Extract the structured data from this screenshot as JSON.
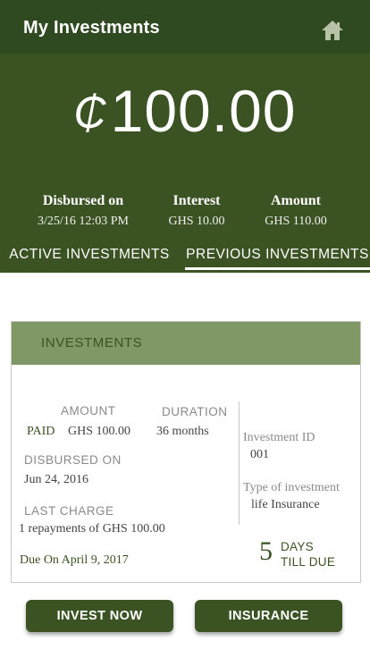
{
  "app": {
    "title": "My Investments"
  },
  "icons": {
    "home": "home-icon"
  },
  "colors": {
    "primary": "#3b5323",
    "topbar": "#2f4a20",
    "card_header": "#7f9866"
  },
  "summary": {
    "currency_symbol": "₵",
    "amount": "100.00",
    "disbursed_label": "Disbursed on",
    "disbursed_value": "3/25/16 12:03 PM",
    "interest_label": "Interest",
    "interest_value": "GHS 10.00",
    "amount_label": "Amount",
    "amount_value": "GHS 110.00"
  },
  "tabs": [
    {
      "label": "ACTIVE INVESTMENTS",
      "selected": false
    },
    {
      "label": "PREVIOUS INVESTMENTS",
      "selected": true
    }
  ],
  "card": {
    "header": "INVESTMENTS",
    "amount_label": "AMOUNT",
    "duration_label": "DURATION",
    "status": "PAID",
    "amount_value": "GHS 100.00",
    "duration_value": "36 months",
    "disbursed_label": "DISBURSED ON",
    "disbursed_value": "Jun 24, 2016",
    "last_charge_label": "LAST CHARGE",
    "last_charge_value": "1 repayments of GHS 100.00",
    "due_on": "Due On April 9, 2017",
    "investment_id_label": "Investment ID",
    "investment_id_value": "001",
    "type_label": "Type of investment",
    "type_value": "life Insurance",
    "days_count": "5",
    "days_label_1": "DAYS",
    "days_label_2": "TILL DUE"
  },
  "buttons": {
    "invest_now": "INVEST NOW",
    "insurance": "INSURANCE"
  }
}
